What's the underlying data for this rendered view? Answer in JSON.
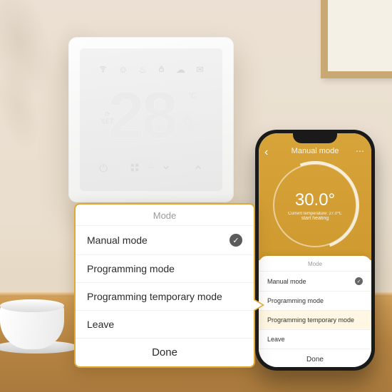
{
  "thermostat": {
    "temp_main": "28",
    "temp_decimal": ".9",
    "unit": "℃",
    "set_label": "⏻\nSET",
    "top_icons": [
      "wifi",
      "smile",
      "flame",
      "lock",
      "cloud",
      "chat"
    ],
    "heat_icon_label": "♨",
    "bottom_icons": [
      "⏻",
      "⊞",
      "⌄",
      "⌃"
    ]
  },
  "phone": {
    "header_title": "Manual mode",
    "dial_temp": "30.0°",
    "dial_current": "Current temperature: 27.0℃",
    "dial_status": "start heating",
    "sheet_header": "Mode",
    "options": [
      {
        "label": "Manual mode",
        "selected": true
      },
      {
        "label": "Programming mode",
        "selected": false
      },
      {
        "label": "Programming temporary mode",
        "selected": false,
        "highlight": true
      },
      {
        "label": "Leave",
        "selected": false
      }
    ],
    "done_label": "Done"
  },
  "callout": {
    "header": "Mode",
    "options": [
      {
        "label": "Manual mode",
        "selected": true
      },
      {
        "label": "Programming mode",
        "selected": false
      },
      {
        "label": "Programming temporary mode",
        "selected": false
      },
      {
        "label": "Leave",
        "selected": false
      }
    ],
    "done_label": "Done"
  }
}
